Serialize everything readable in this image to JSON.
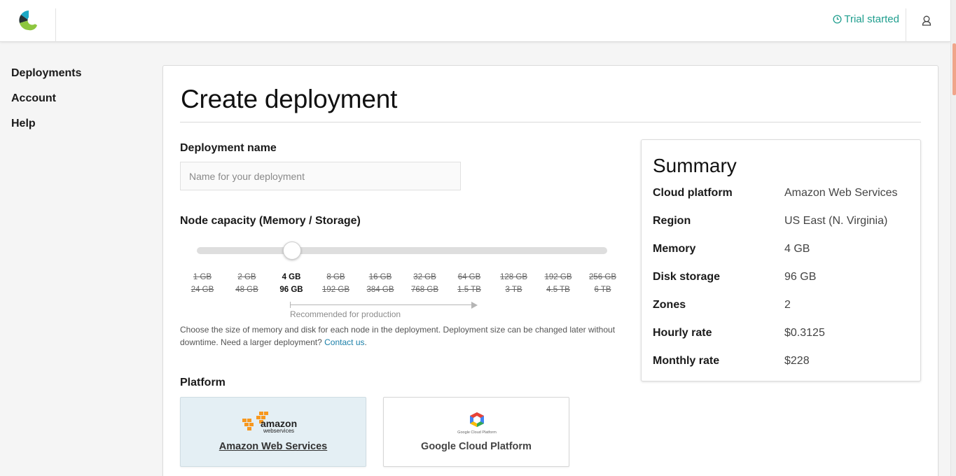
{
  "header": {
    "trial_text": "Trial started"
  },
  "sidebar": {
    "items": [
      {
        "label": "Deployments"
      },
      {
        "label": "Account"
      },
      {
        "label": "Help"
      }
    ]
  },
  "main": {
    "title": "Create deployment",
    "deployment_name_label": "Deployment name",
    "deployment_name_placeholder": "Name for your deployment",
    "deployment_name_value": "",
    "capacity_label": "Node capacity (Memory / Storage)",
    "capacity_options": [
      {
        "memory": "1 GB",
        "storage": "24 GB"
      },
      {
        "memory": "2 GB",
        "storage": "48 GB"
      },
      {
        "memory": "4 GB",
        "storage": "96 GB"
      },
      {
        "memory": "8 GB",
        "storage": "192 GB"
      },
      {
        "memory": "16 GB",
        "storage": "384 GB"
      },
      {
        "memory": "32 GB",
        "storage": "768 GB"
      },
      {
        "memory": "64 GB",
        "storage": "1.5 TB"
      },
      {
        "memory": "128 GB",
        "storage": "3 TB"
      },
      {
        "memory": "192 GB",
        "storage": "4.5 TB"
      },
      {
        "memory": "256 GB",
        "storage": "6 TB"
      }
    ],
    "capacity_selected_index": 2,
    "recommended_text": "Recommended for production",
    "help_text": "Choose the size of memory and disk for each node in the deployment. Deployment size can be changed later without downtime. Need a larger deployment? ",
    "contact_link": "Contact us",
    "help_text_end": ".",
    "platform_label": "Platform",
    "platforms": [
      {
        "label": "Amazon Web Services",
        "selected": true,
        "icon": "aws-logo"
      },
      {
        "label": "Google Cloud Platform",
        "selected": false,
        "icon": "gcp-logo"
      }
    ]
  },
  "summary": {
    "title": "Summary",
    "rows": [
      {
        "key": "Cloud platform",
        "value": "Amazon Web Services"
      },
      {
        "key": "Region",
        "value": "US East (N. Virginia)"
      },
      {
        "key": "Memory",
        "value": "4 GB"
      },
      {
        "key": "Disk storage",
        "value": "96 GB"
      },
      {
        "key": "Zones",
        "value": "2"
      },
      {
        "key": "Hourly rate",
        "value": "$0.3125"
      },
      {
        "key": "Monthly rate",
        "value": "$228"
      }
    ]
  },
  "colors": {
    "accent": "#1f9e8e",
    "link": "#1a7fa8",
    "selected_platform_bg": "#e4eff4",
    "aws_orange": "#f7981f"
  },
  "logos": {
    "aws_word": "amazon",
    "aws_sub": "webservices",
    "gcp_caption": "Google Cloud Platform"
  }
}
